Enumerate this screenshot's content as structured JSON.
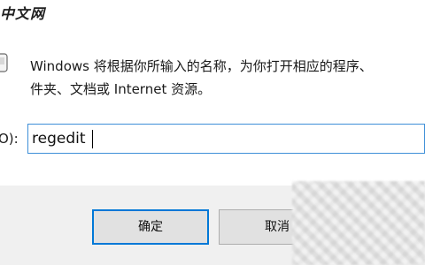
{
  "watermark": {
    "text": "中文网"
  },
  "dialog": {
    "message_line1": "Windows 将根据你所输入的名称，为你打开相应的程序、",
    "message_line2": "件夹、文档或 Internet 资源。",
    "open_label": "O):",
    "open_value": "regedit",
    "ok_label": "确定",
    "cancel_label": "取消"
  },
  "colors": {
    "input_border": "#3e8fd8",
    "ok_border": "#0078d7",
    "footer_bg": "#f0f0f0",
    "button_bg": "#e1e1e1"
  },
  "icons": {
    "run": "run-program-icon"
  }
}
